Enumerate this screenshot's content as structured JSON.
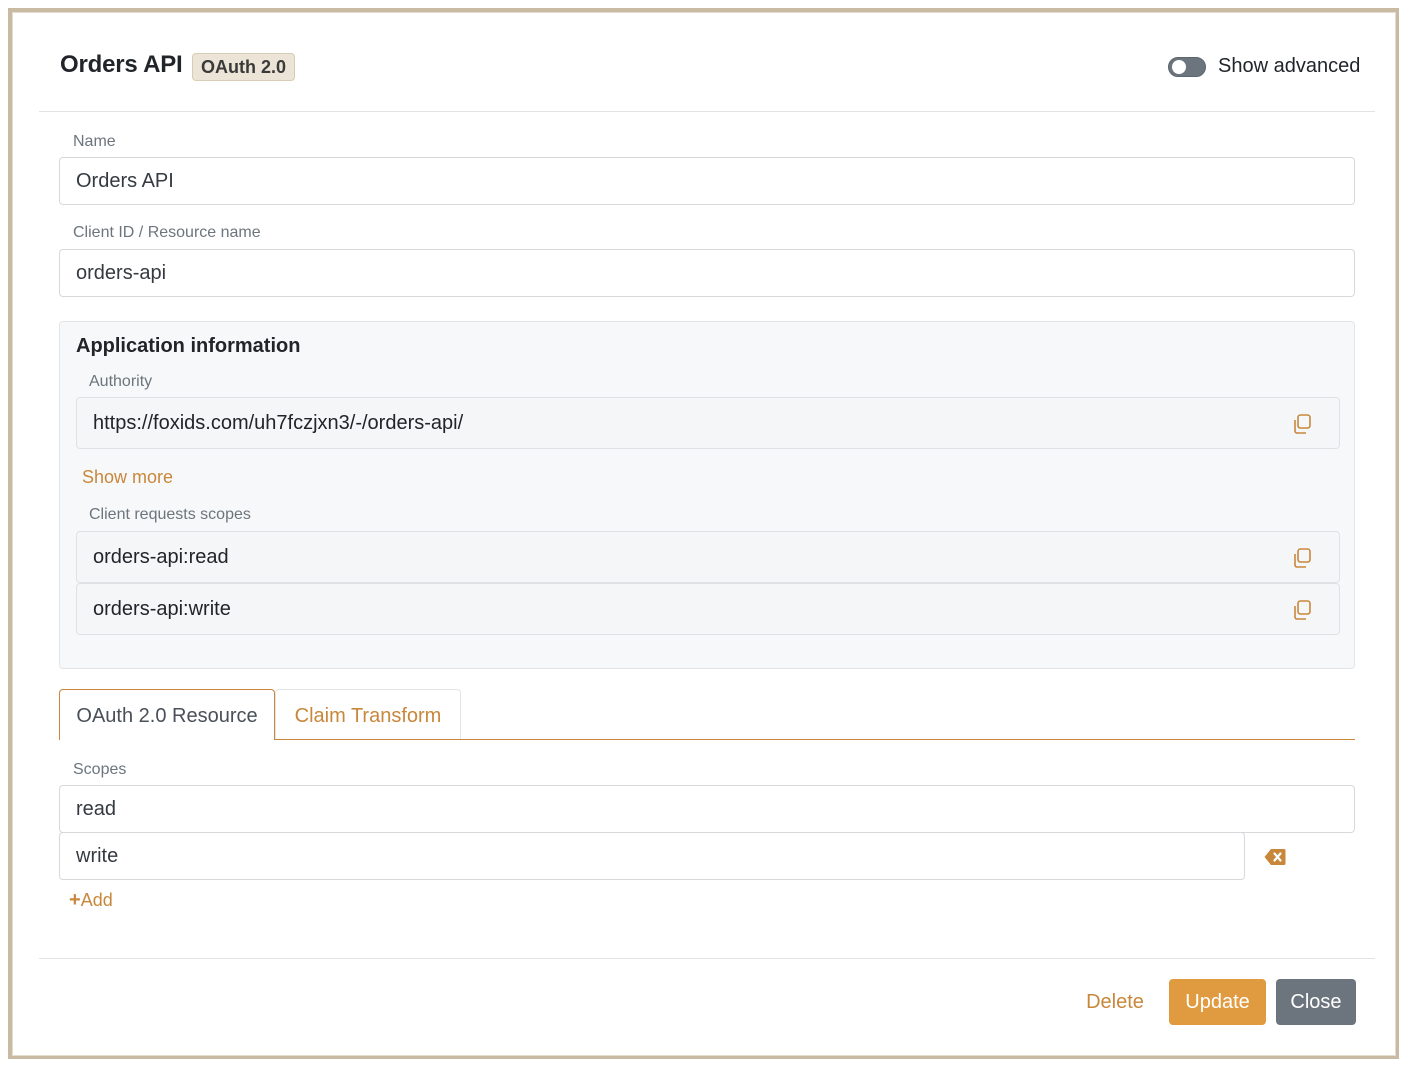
{
  "header": {
    "title": "Orders API",
    "badge": "OAuth 2.0",
    "toggle_label": "Show advanced",
    "toggle_on": false
  },
  "form": {
    "name_label": "Name",
    "name_value": "Orders API",
    "client_id_label": "Client ID / Resource name",
    "client_id_value": "orders-api"
  },
  "app_info": {
    "title": "Application information",
    "authority_label": "Authority",
    "authority_value": "https://foxids.com/uh7fczjxn3/-/orders-api/",
    "show_more": "Show more",
    "scopes_label": "Client requests scopes",
    "scopes": [
      "orders-api:read",
      "orders-api:write"
    ]
  },
  "tabs": [
    {
      "label": "OAuth 2.0 Resource",
      "active": true
    },
    {
      "label": "Claim Transform",
      "active": false
    }
  ],
  "resource": {
    "scopes_label": "Scopes",
    "scopes": [
      "read",
      "write"
    ],
    "add_label": "Add"
  },
  "footer": {
    "delete_label": "Delete",
    "update_label": "Update",
    "close_label": "Close"
  },
  "colors": {
    "accent": "#c8873b",
    "primary_button": "#e09a3f",
    "secondary_button": "#6c757d"
  }
}
